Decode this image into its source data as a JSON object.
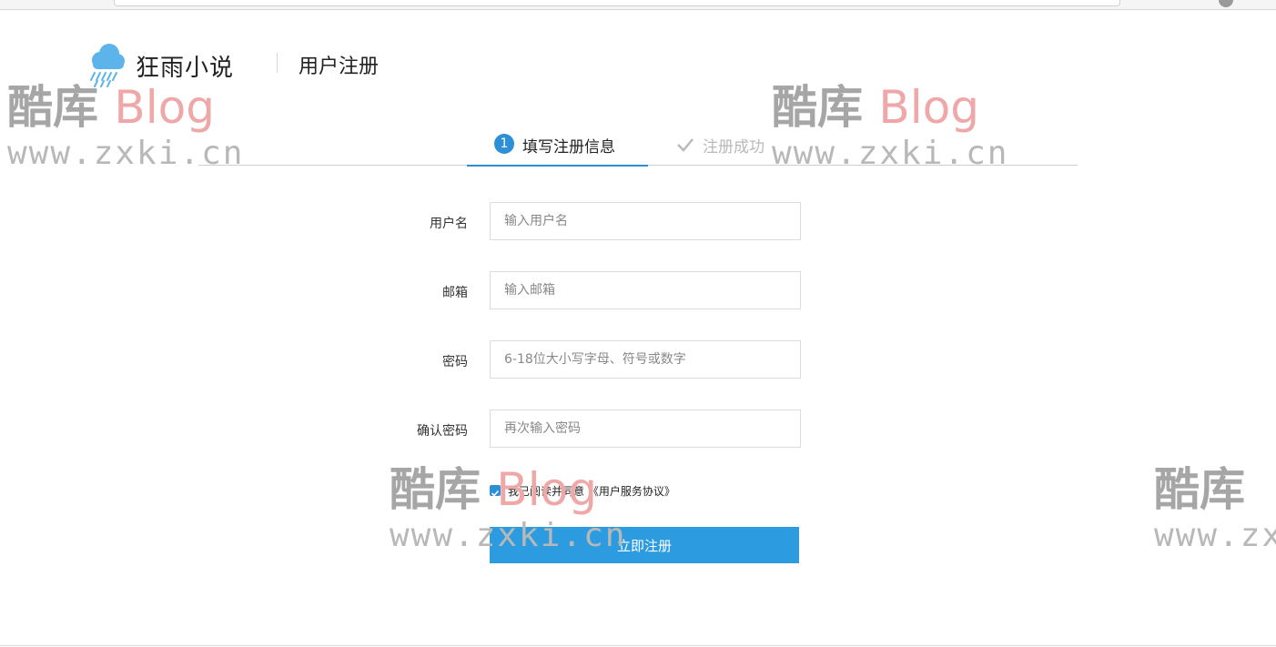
{
  "header": {
    "brand": "狂雨小说",
    "page_title": "用户注册"
  },
  "steps": [
    {
      "number": "1",
      "label": "填写注册信息",
      "active": true
    },
    {
      "label": "注册成功",
      "active": false,
      "icon": "check-icon"
    }
  ],
  "form": {
    "username": {
      "label": "用户名",
      "placeholder": "输入用户名",
      "value": ""
    },
    "email": {
      "label": "邮箱",
      "placeholder": "输入邮箱",
      "value": ""
    },
    "password": {
      "label": "密码",
      "placeholder": "6-18位大小写字母、符号或数字",
      "value": ""
    },
    "confirm": {
      "label": "确认密码",
      "placeholder": "再次输入密码",
      "value": ""
    },
    "agreement": {
      "text": "我已阅读并同意 《用户服务协议》",
      "checked": true
    },
    "submit_label": "立即注册"
  },
  "watermark": {
    "cn": "酷库",
    "blog": "Blog",
    "url": "www.zxki.cn"
  },
  "colors": {
    "accent": "#2d8fd5",
    "button": "#2d9be0",
    "inactive_step": "#b9b9b9"
  }
}
